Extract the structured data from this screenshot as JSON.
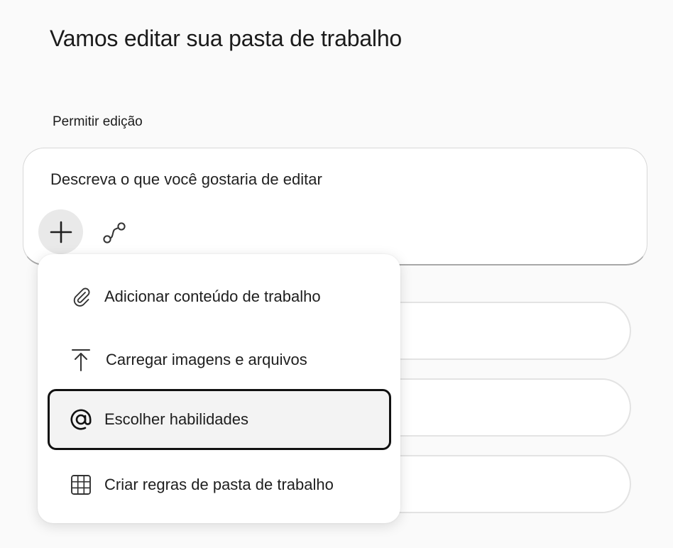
{
  "page": {
    "title": "Vamos editar sua pasta de trabalho"
  },
  "edit_section": {
    "label": "Permitir edição",
    "prompt": {
      "placeholder": "Descreva o que você gostaria de editar",
      "add_icon": "plus-icon",
      "connect_icon": "connection-icon"
    }
  },
  "add_menu": {
    "items": [
      {
        "label": "Adicionar conteúdo de trabalho",
        "icon": "paperclip-icon",
        "focused": false
      },
      {
        "label": "Carregar imagens e arquivos",
        "icon": "upload-icon",
        "focused": false
      },
      {
        "label": "Escolher habilidades",
        "icon": "at-sign-icon",
        "focused": true
      },
      {
        "label": "Criar regras de pasta de trabalho",
        "icon": "table-grid-icon",
        "focused": false
      }
    ]
  },
  "colors": {
    "background": "#fafafa",
    "surface": "#ffffff",
    "focus_border": "#111111",
    "focus_fill": "#f3f3f3",
    "add_button_fill": "#e9e9e9"
  }
}
